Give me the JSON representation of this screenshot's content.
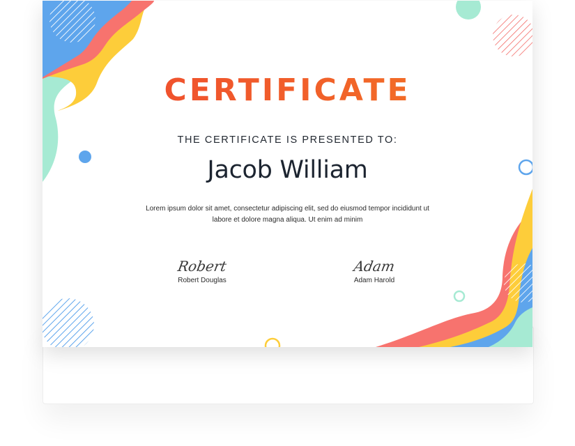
{
  "certificate": {
    "title": "CERTIFICATE",
    "subtitle": "THE CERTIFICATE IS PRESENTED TO:",
    "recipient": "Jacob William",
    "body": "Lorem ipsum dolor sit amet, consectetur adipiscing elit, sed do eiusmod tempor incididunt ut labore et dolore magna aliqua. Ut enim ad minim",
    "signatures": [
      {
        "signature": "Robert",
        "name": "Robert Douglas"
      },
      {
        "signature": "Adam",
        "name": "Adam Harold"
      }
    ]
  },
  "colors": {
    "title": "#ef4730",
    "blue": "#5ea5ec",
    "coral": "#f7736e",
    "yellow": "#fdcd3a",
    "mint": "#a6ead3"
  }
}
